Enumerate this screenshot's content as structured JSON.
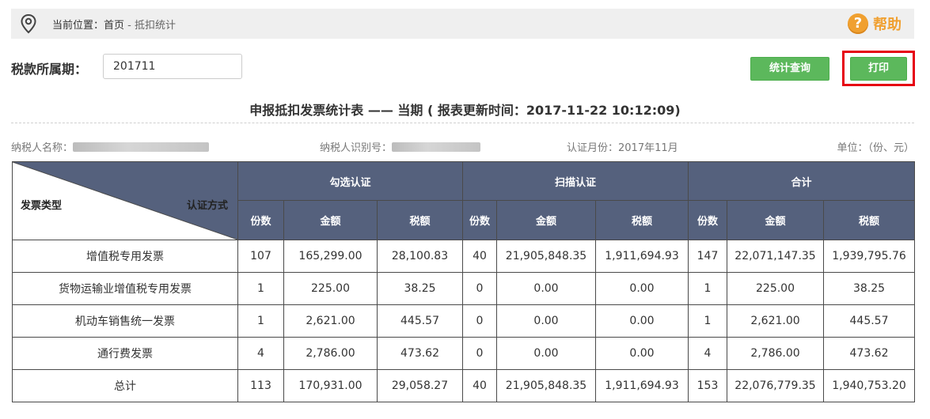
{
  "breadcrumb": {
    "prefix": "当前位置：",
    "home": "首页",
    "sep": " - ",
    "current": "抵扣统计"
  },
  "help": {
    "icon_name": "question-circle-icon",
    "label": "帮助"
  },
  "filter": {
    "label": "税款所属期：",
    "value": "201711"
  },
  "buttons": {
    "query": "统计查询",
    "print": "打印"
  },
  "report": {
    "title": "申报抵扣发票统计表 —— 当期 ( 报表更新时间：2017-11-22 10:12:09)",
    "taxpayer_name_label": "纳税人名称：",
    "taxpayer_id_label": "纳税人识别号：",
    "cert_month": "认证月份：2017年11月",
    "unit": "单位：（份、元）"
  },
  "table": {
    "corner_left": "发票类型",
    "corner_right": "认证方式",
    "groups": [
      "勾选认证",
      "扫描认证",
      "合计"
    ],
    "subheaders": [
      "份数",
      "金额",
      "税额",
      "份数",
      "金额",
      "税额",
      "份数",
      "金额",
      "税额"
    ],
    "rows": [
      [
        "增值税专用发票",
        "107",
        "165,299.00",
        "28,100.83",
        "40",
        "21,905,848.35",
        "1,911,694.93",
        "147",
        "22,071,147.35",
        "1,939,795.76"
      ],
      [
        "货物运输业增值税专用发票",
        "1",
        "225.00",
        "38.25",
        "0",
        "0.00",
        "0.00",
        "1",
        "225.00",
        "38.25"
      ],
      [
        "机动车销售统一发票",
        "1",
        "2,621.00",
        "445.57",
        "0",
        "0.00",
        "0.00",
        "1",
        "2,621.00",
        "445.57"
      ],
      [
        "通行费发票",
        "4",
        "2,786.00",
        "473.62",
        "0",
        "0.00",
        "0.00",
        "4",
        "2,786.00",
        "473.62"
      ],
      [
        "总计",
        "113",
        "170,931.00",
        "29,058.27",
        "40",
        "21,905,848.35",
        "1,911,694.93",
        "153",
        "22,076,779.35",
        "1,940,753.20"
      ]
    ]
  },
  "colors": {
    "header_bg": "#55617d",
    "button_green": "#5cb85c",
    "help_orange": "#f0a030",
    "highlight_red": "#e60012"
  }
}
